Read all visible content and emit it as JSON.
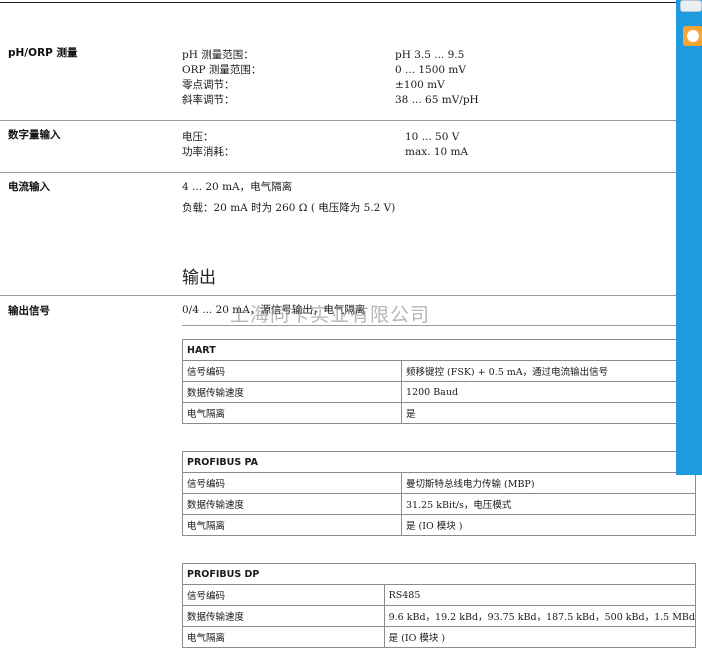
{
  "measurement": {
    "label": "pH/ORP 测量",
    "rows": [
      {
        "name": "pH 测量范围：",
        "value": "pH 3.5 ... 9.5"
      },
      {
        "name": "ORP 测量范围：",
        "value": "0 ... 1500 mV"
      },
      {
        "name": "零点调节：",
        "value": "±100 mV"
      },
      {
        "name": "斜率调节：",
        "value": "38 ... 65 mV/pH"
      }
    ]
  },
  "digital_input": {
    "label": "数字量输入",
    "rows": [
      {
        "name": "电压：",
        "value": "10 ... 50 V"
      },
      {
        "name": "功率消耗：",
        "value": "max. 10 mA"
      }
    ]
  },
  "current_input": {
    "label": "电流输入",
    "lines": [
      "4 ... 20 mA，电气隔离",
      "负载：20 mA 时为 260 Ω ( 电压降为 5.2 V)"
    ]
  },
  "output_heading": "输出",
  "output_signal": {
    "label": "输出信号",
    "text": "0/4 ... 20 mA，源信号输出，电气隔离"
  },
  "watermark": "上海同卡实业有限公司",
  "tables": [
    {
      "title": "HART",
      "rows": [
        [
          "信号编码",
          "频移键控 (FSK) + 0.5 mA，通过电流输出信号"
        ],
        [
          "数据传输速度",
          "1200 Baud"
        ],
        [
          "电气隔离",
          "是"
        ]
      ]
    },
    {
      "title": "PROFIBUS PA",
      "rows": [
        [
          "信号编码",
          "曼切斯特总线电力传输 (MBP)"
        ],
        [
          "数据传输速度",
          "31.25 kBit/s，电压模式"
        ],
        [
          "电气隔离",
          "是 (IO 模块 )"
        ]
      ]
    },
    {
      "title": "PROFIBUS DP",
      "rows": [
        [
          "信号编码",
          "RS485"
        ],
        [
          "数据传输速度",
          "9.6 kBd，19.2 kBd，93.75 kBd，187.5 kBd，500 kBd，1.5 MBd"
        ],
        [
          "电气隔离",
          "是 (IO 模块 )"
        ]
      ]
    }
  ],
  "colors": {
    "side_tab": "#1e9be0",
    "widget_accent": "#f7a534"
  },
  "icons": [
    "toolbar-widget-icon",
    "chat-widget-icon"
  ]
}
